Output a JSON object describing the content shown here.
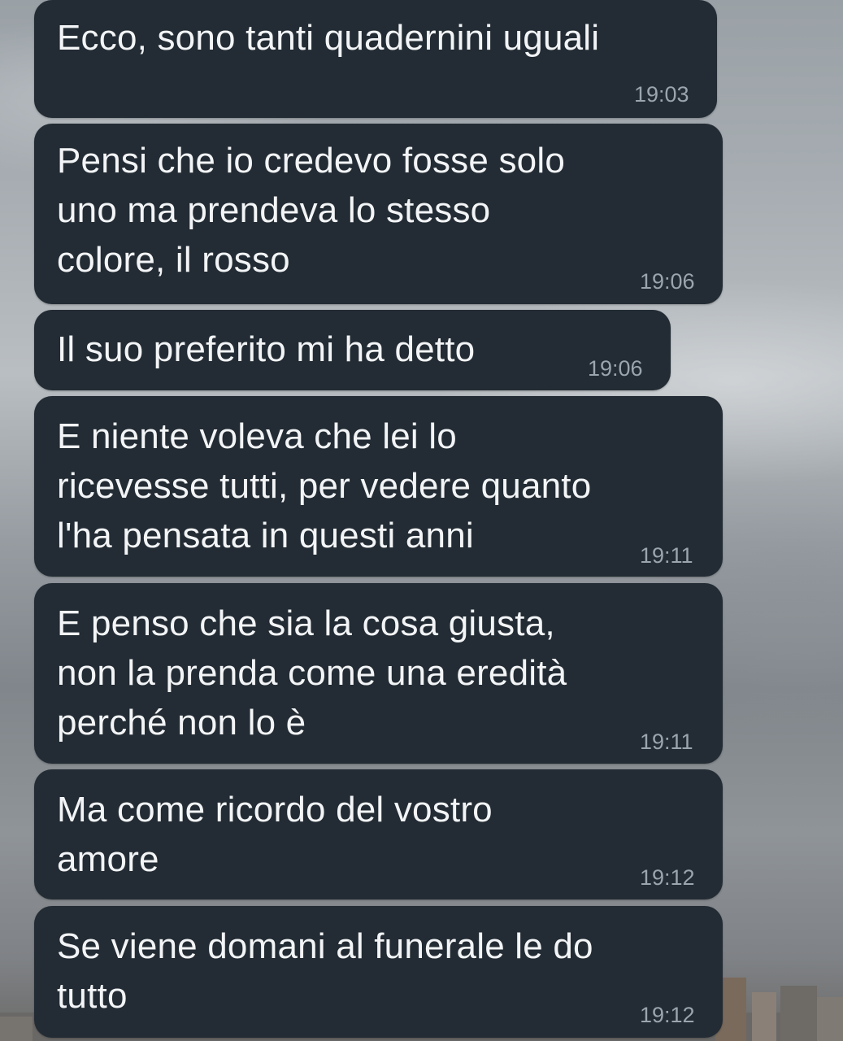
{
  "messages": [
    {
      "text": "Ecco, sono tanti quadernini uguali",
      "time": "19:03"
    },
    {
      "text": "Pensi che io credevo fosse solo\nuno ma prendeva lo stesso\ncolore, il rosso",
      "time": "19:06"
    },
    {
      "text": "Il suo preferito mi ha detto",
      "time": "19:06"
    },
    {
      "text": "E niente voleva che lei lo\nricevesse tutti, per vedere quanto\nl'ha pensata in questi anni",
      "time": "19:11"
    },
    {
      "text": "E penso che sia la cosa giusta,\nnon la prenda come una eredità\nperché non lo è",
      "time": "19:11"
    },
    {
      "text": "Ma come ricordo del vostro\namore",
      "time": "19:12"
    },
    {
      "text": "Se viene domani al funerale le do\ntutto",
      "time": "19:12"
    }
  ],
  "colors": {
    "bubble": "#232c34",
    "text": "#f2f4f6",
    "time": "#9aa5ae"
  }
}
